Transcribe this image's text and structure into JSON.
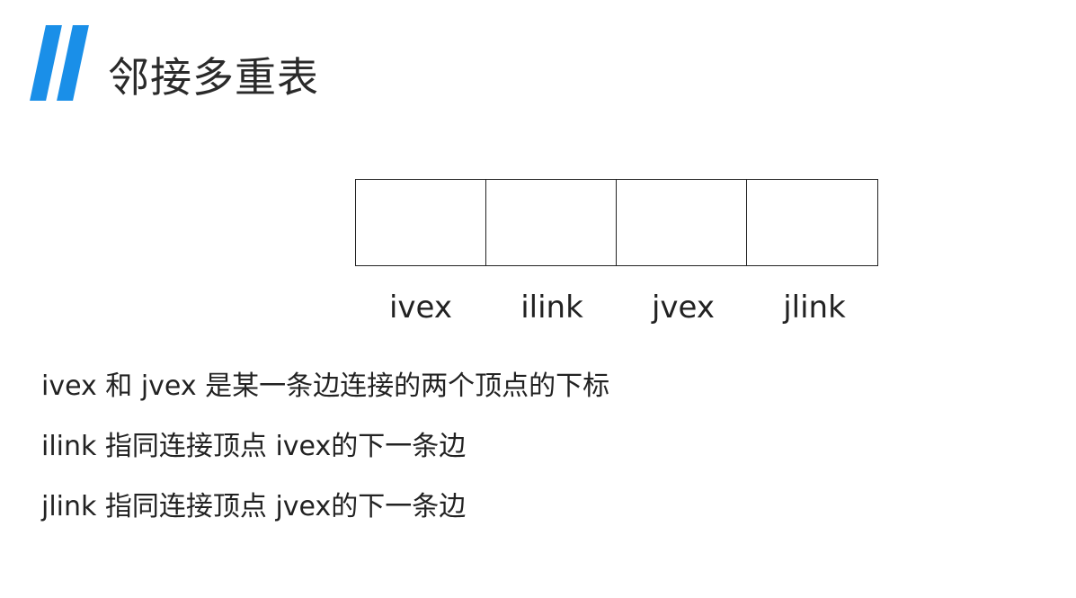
{
  "title": "邻接多重表",
  "node_fields": [
    "ivex",
    "ilink",
    "jvex",
    "jlink"
  ],
  "descriptions": [
    "ivex 和 jvex 是某一条边连接的两个顶点的下标",
    "ilink 指同连接顶点 ivex的下一条边",
    "jlink 指同连接顶点 jvex的下一条边"
  ],
  "colors": {
    "accent": "#1a8fe8",
    "text": "#222222",
    "background": "#ffffff"
  }
}
